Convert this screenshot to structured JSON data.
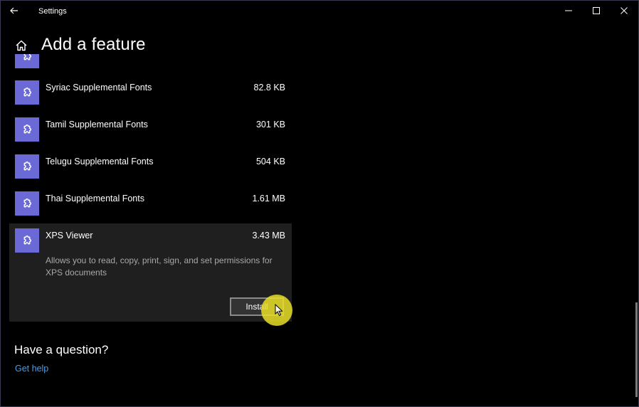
{
  "window": {
    "app_title": "Settings",
    "controls": {
      "back_icon": "arrow-left-icon",
      "minimize_icon": "minimize-icon",
      "maximize_icon": "maximize-icon",
      "close_icon": "close-icon"
    }
  },
  "header": {
    "home_icon": "home-icon",
    "title": "Add a feature"
  },
  "features": [
    {
      "name": "",
      "size": "",
      "icon": "puzzle-icon"
    },
    {
      "name": "Syriac Supplemental Fonts",
      "size": "82.8 KB",
      "icon": "puzzle-icon"
    },
    {
      "name": "Tamil Supplemental Fonts",
      "size": "301 KB",
      "icon": "puzzle-icon"
    },
    {
      "name": "Telugu Supplemental Fonts",
      "size": "504 KB",
      "icon": "puzzle-icon"
    },
    {
      "name": "Thai Supplemental Fonts",
      "size": "1.61 MB",
      "icon": "puzzle-icon"
    },
    {
      "name": "XPS Viewer",
      "size": "3.43 MB",
      "icon": "puzzle-icon",
      "selected": true,
      "description": "Allows you to read, copy, print, sign, and set permissions for XPS documents",
      "install_label": "Install"
    }
  ],
  "question": {
    "title": "Have a question?",
    "link": "Get help"
  },
  "colors": {
    "background": "#000000",
    "accent_tile": "#6b69d6",
    "selected_bg": "#1f1f1f",
    "link": "#4d9be6",
    "cursor_highlight": "#e8de28"
  }
}
